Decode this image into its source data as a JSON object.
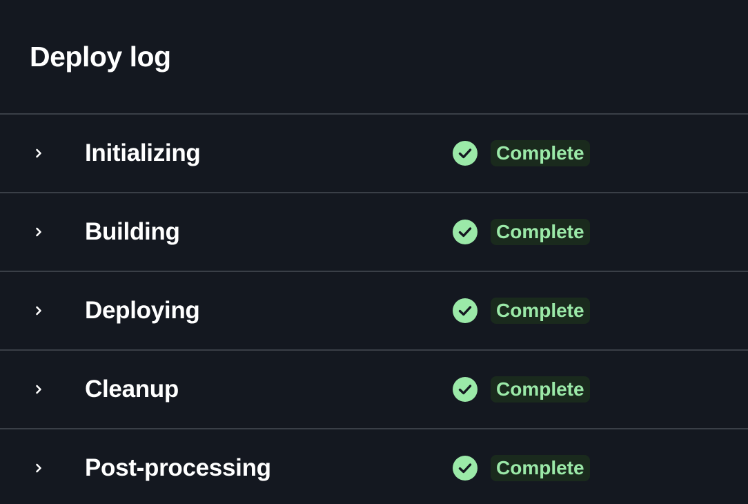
{
  "header": {
    "title": "Deploy log"
  },
  "colors": {
    "background": "#141820",
    "divider": "#3a3f47",
    "success_icon": "#9be9a8",
    "badge_bg": "#1a2a1d",
    "badge_text": "#9be9a8"
  },
  "steps": [
    {
      "label": "Initializing",
      "status": "Complete",
      "status_icon": "check-circle-icon",
      "expand_icon": "chevron-right-icon"
    },
    {
      "label": "Building",
      "status": "Complete",
      "status_icon": "check-circle-icon",
      "expand_icon": "chevron-right-icon"
    },
    {
      "label": "Deploying",
      "status": "Complete",
      "status_icon": "check-circle-icon",
      "expand_icon": "chevron-right-icon"
    },
    {
      "label": "Cleanup",
      "status": "Complete",
      "status_icon": "check-circle-icon",
      "expand_icon": "chevron-right-icon"
    },
    {
      "label": "Post-processing",
      "status": "Complete",
      "status_icon": "check-circle-icon",
      "expand_icon": "chevron-right-icon"
    }
  ]
}
